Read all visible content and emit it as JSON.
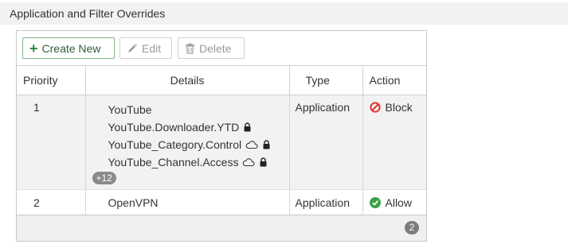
{
  "section": {
    "title": "Application and Filter Overrides"
  },
  "toolbar": {
    "create_label": "Create New",
    "edit_label": "Edit",
    "delete_label": "Delete"
  },
  "table": {
    "columns": [
      "Priority",
      "Details",
      "Type",
      "Action"
    ],
    "rows": [
      {
        "priority": "1",
        "details": [
          {
            "text": "YouTube",
            "icons": []
          },
          {
            "text": "YouTube.Downloader.YTD",
            "icons": [
              "lock-icon"
            ]
          },
          {
            "text": "YouTube_Category.Control",
            "icons": [
              "cloud-icon",
              "lock-icon"
            ]
          },
          {
            "text": "YouTube_Channel.Access",
            "icons": [
              "cloud-icon",
              "lock-icon"
            ]
          }
        ],
        "more": "+12",
        "type": "Application",
        "action": "Block",
        "action_icon": "block-icon"
      },
      {
        "priority": "2",
        "details": [
          {
            "text": "OpenVPN",
            "icons": []
          }
        ],
        "type": "Application",
        "action": "Allow",
        "action_icon": "allow-check-icon"
      }
    ]
  },
  "footer": {
    "count": "2"
  },
  "colors": {
    "block": "#e0352b",
    "allow": "#3aa24a",
    "create_accent": "#2e8b3c"
  }
}
